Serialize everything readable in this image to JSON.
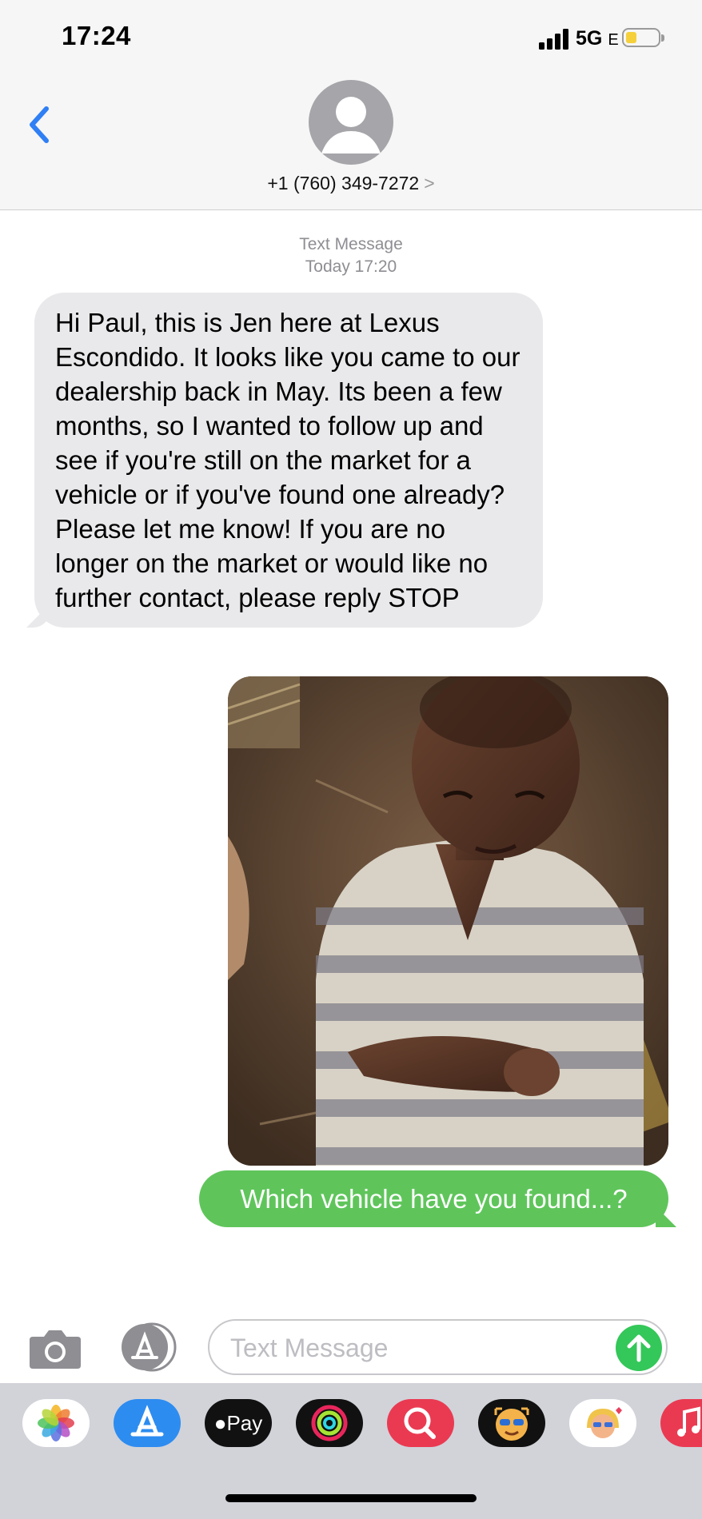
{
  "status_bar": {
    "time": "17:24",
    "network": "5G",
    "network_suffix": "E"
  },
  "header": {
    "contact_phone": "+1 (760) 349-7272",
    "contact_chevron": ">"
  },
  "thread": {
    "service": "Text Message",
    "timestamp": "Today 17:20",
    "incoming_message": "Hi Paul, this is Jen here at Lexus Escondido. It looks like you came to our dealership back in May. Its been a few months, so I wanted to follow up and see if you're still on the market for a vehicle or if you've found one already? Please let me know! If you are no longer on the market or would like no further contact, please reply STOP",
    "outgoing_message": "Which vehicle have you found...?"
  },
  "compose": {
    "placeholder": "Text Message"
  },
  "app_drawer": {
    "apple_pay_label": "Pay",
    "apps": [
      "photos-icon",
      "app-store-icon",
      "apple-pay-icon",
      "activity-icon",
      "image-search-icon",
      "memoji-icon",
      "memoji-stickers-icon",
      "music-icon"
    ]
  },
  "colors": {
    "ios_blue": "#2f7ff5",
    "incoming_bubble": "#e9e9eb",
    "outgoing_bubble": "#5fc55b",
    "send_green": "#34c759",
    "battery_yellow": "#f5d03b"
  }
}
